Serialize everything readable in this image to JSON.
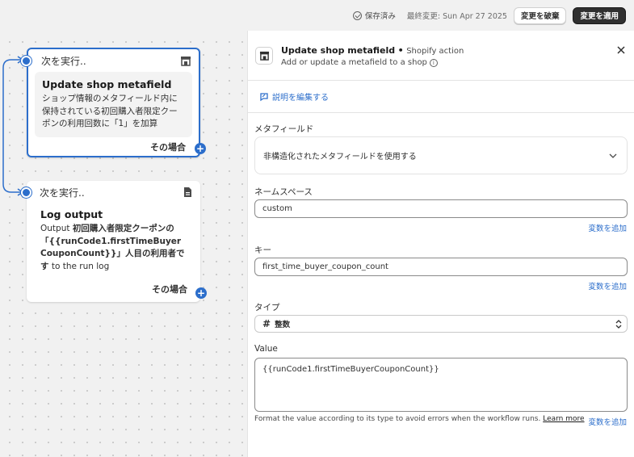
{
  "topbar": {
    "saved": "保存済み",
    "last_modified": "最終変更: Sun Apr 27 2025",
    "discard_label": "変更を破棄",
    "apply_label": "変更を適用"
  },
  "canvas": {
    "cards": [
      {
        "run_next": "次を実行..",
        "icon": "store-icon",
        "title": "Update shop metafield",
        "desc": "ショップ情報のメタフィールド内に保持されている初回購入者限定クーポンの利用回数に「1」を加算",
        "footer": "その場合"
      },
      {
        "run_next": "次を実行..",
        "icon": "document-icon",
        "title": "Log output",
        "desc_pre": "Output ",
        "desc_bold": "初回購入者限定クーポンの「{{runCode1.firstTimeBuyerCouponCount}}」人目の利用者です",
        "desc_post": " to the run log",
        "footer": "その場合"
      }
    ]
  },
  "panel": {
    "title": "Update shop metafield",
    "separator": "•",
    "app": "Shopify action",
    "subtitle": "Add or update a metafield to a shop",
    "edit_description": "説明を編集する",
    "metafield": {
      "label": "メタフィールド",
      "value": "非構造化されたメタフィールドを使用する"
    },
    "namespace": {
      "label": "ネームスペース",
      "value": "custom",
      "add_variable": "変数を追加"
    },
    "key": {
      "label": "キー",
      "value": "first_time_buyer_coupon_count",
      "add_variable": "変数を追加"
    },
    "type": {
      "label": "タイプ",
      "value": "整数"
    },
    "value": {
      "label": "Value",
      "value": "{{runCode1.firstTimeBuyerCouponCount}}",
      "hint": "Format the value according to its type to avoid errors when the workflow runs.",
      "learn_more": "Learn more",
      "add_variable": "変数を追加"
    }
  },
  "colors": {
    "accent": "#2c6ecb",
    "dark_button": "#303030"
  }
}
